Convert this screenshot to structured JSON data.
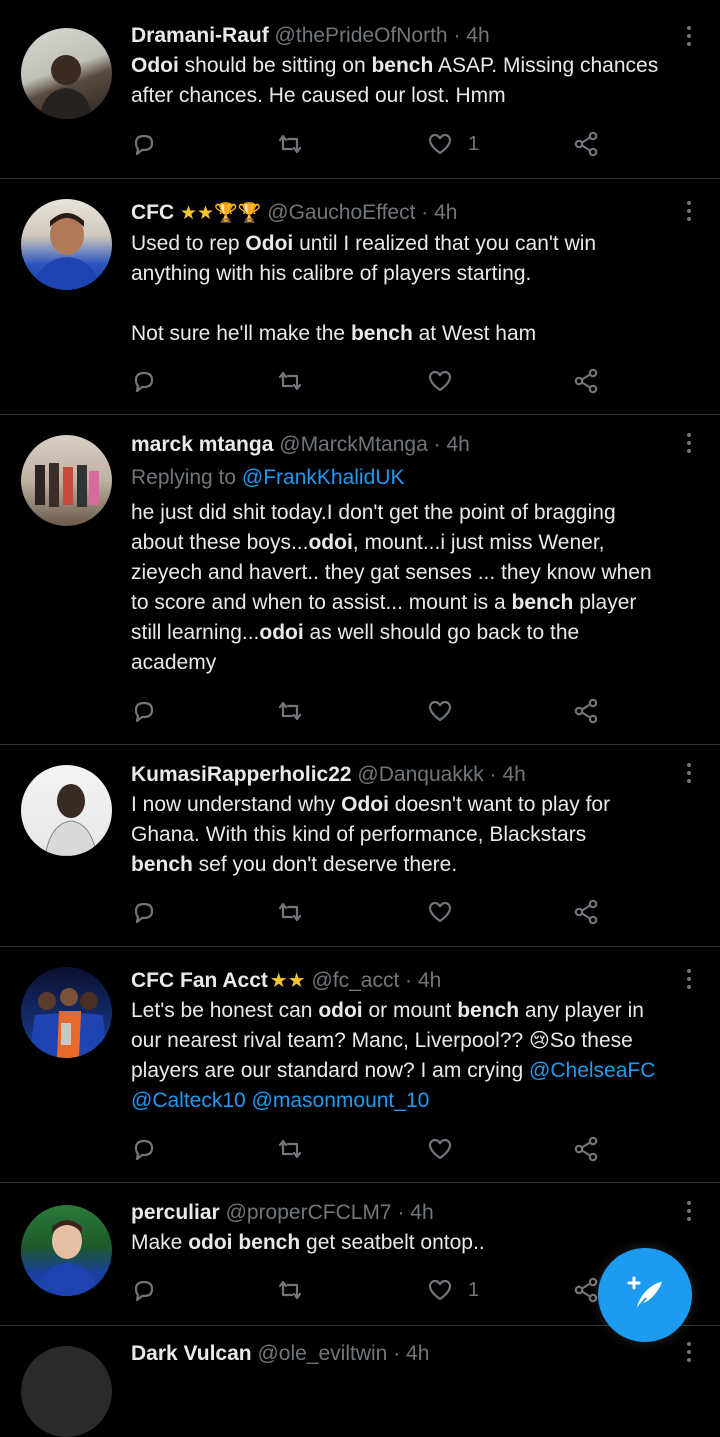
{
  "colors": {
    "background": "#000000",
    "text": "#e7e9ea",
    "muted": "#71767b",
    "accent": "#1d9bf0",
    "divider": "#2f3336"
  },
  "tweets": [
    {
      "name": "Dramani-Rauf",
      "handle": "@thePrideOfNorth",
      "dot": "·",
      "time": "4h",
      "lines": [
        [
          {
            "t": "Odoi",
            "b": true
          },
          {
            "t": " should be sitting on "
          },
          {
            "t": "bench",
            "b": true
          },
          {
            "t": " ASAP. Missing chances"
          }
        ],
        [
          {
            "t": "after chances. He caused our lost. Hmm"
          }
        ]
      ],
      "like_count": "1"
    },
    {
      "name": "CFC",
      "badges": "★★🏆🏆",
      "handle": "@GauchoEffect",
      "dot": "·",
      "time": "4h",
      "lines": [
        [
          {
            "t": "Used to rep "
          },
          {
            "t": "Odoi",
            "b": true
          },
          {
            "t": " until I realized that you can't win"
          }
        ],
        [
          {
            "t": "anything with his calibre of players starting."
          }
        ],
        [
          {
            "t": ""
          }
        ],
        [
          {
            "t": "Not sure he'll make the "
          },
          {
            "t": "bench",
            "b": true
          },
          {
            "t": " at West ham"
          }
        ]
      ],
      "like_count": ""
    },
    {
      "name": "marck mtanga",
      "handle": "@MarckMtanga",
      "dot": "·",
      "time": "4h",
      "reply_prefix": "Replying to ",
      "reply_to": "@FrankKhalidUK",
      "lines": [
        [
          {
            "t": "he just did shit today.I don't get the point of bragging"
          }
        ],
        [
          {
            "t": "about these boys..."
          },
          {
            "t": "odoi",
            "b": true
          },
          {
            "t": ", mount...i just miss Wener,"
          }
        ],
        [
          {
            "t": "zieyech and havert.. they gat senses ... they know when"
          }
        ],
        [
          {
            "t": "to score and when to assist... mount is a "
          },
          {
            "t": "bench",
            "b": true
          },
          {
            "t": " player"
          }
        ],
        [
          {
            "t": "still learning..."
          },
          {
            "t": "odoi",
            "b": true
          },
          {
            "t": " as well should go back to the"
          }
        ],
        [
          {
            "t": "academy"
          }
        ]
      ],
      "like_count": ""
    },
    {
      "name": "KumasiRapperholic22",
      "handle": "@Danquakkk",
      "dot": "·",
      "time": "4h",
      "lines": [
        [
          {
            "t": "I now understand why "
          },
          {
            "t": "Odoi",
            "b": true
          },
          {
            "t": " doesn't want to play for"
          }
        ],
        [
          {
            "t": "Ghana. With this kind of performance, Blackstars"
          }
        ],
        [
          {
            "t": "bench",
            "b": true
          },
          {
            "t": " sef you don't deserve there."
          }
        ]
      ],
      "like_count": ""
    },
    {
      "name": "CFC Fan Acct",
      "badges": "★★",
      "handle": "@fc_acct",
      "dot": "·",
      "time": "4h",
      "lines": [
        [
          {
            "t": "Let's be honest can "
          },
          {
            "t": "odoi",
            "b": true
          },
          {
            "t": " or mount "
          },
          {
            "t": "bench",
            "b": true
          },
          {
            "t": " any player in"
          }
        ],
        [
          {
            "t": "our nearest rival team? Manc, Liverpool?? "
          },
          {
            "t": "😢",
            "emoji": true
          },
          {
            "t": "So these"
          }
        ],
        [
          {
            "t": "players are our standard now? I am crying "
          },
          {
            "t": "@ChelseaFC",
            "link": true
          }
        ],
        [
          {
            "t": "@Calteck10",
            "link": true
          },
          {
            "t": " "
          },
          {
            "t": "@masonmount_10",
            "link": true
          }
        ]
      ],
      "like_count": ""
    },
    {
      "name": "perculiar",
      "handle": "@properCFCLM7",
      "dot": "·",
      "time": "4h",
      "lines": [
        [
          {
            "t": "Make "
          },
          {
            "t": "odoi bench",
            "b": true
          },
          {
            "t": " get seatbelt ontop.."
          }
        ]
      ],
      "like_count": "1"
    },
    {
      "name": "Dark Vulcan",
      "handle": "@ole_eviltwin",
      "dot": "·",
      "time": "4h",
      "lines": [],
      "like_count": ""
    }
  ],
  "icons": {
    "reply": "reply-icon",
    "retweet": "retweet-icon",
    "like": "heart-icon",
    "share": "share-icon",
    "more": "more-options-icon",
    "compose": "compose-tweet-icon"
  }
}
